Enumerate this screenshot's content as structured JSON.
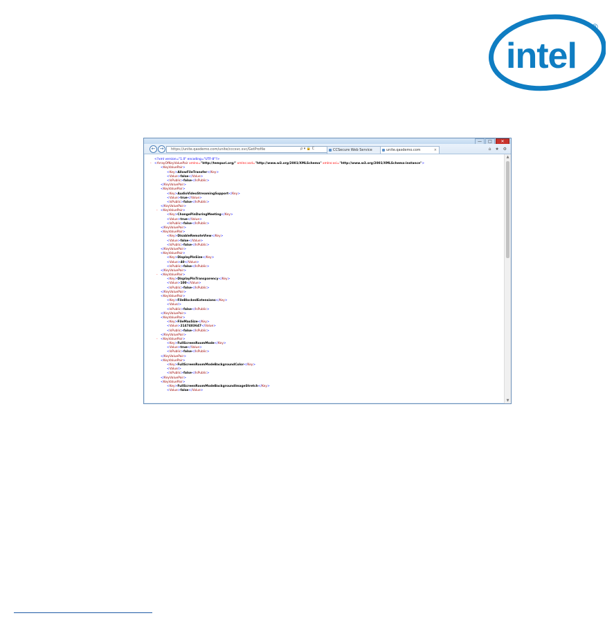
{
  "logo": {
    "text": "intel"
  },
  "browser": {
    "window_buttons": [
      "—",
      "□",
      "✕"
    ],
    "back_glyph": "←",
    "forward_glyph": "→",
    "address_url": "https://unite.qasdemo.com/unite/cccsvc.svc/GetProfile",
    "address_icons": "ρ ▾ 🔒 C",
    "tabs": [
      {
        "label": "CCSecure Web Service",
        "active": false
      },
      {
        "label": "unite.qasdemo.com",
        "active": true
      }
    ],
    "toolbar_icons": "⌂ ★ ⚙",
    "scroll_up": "▲",
    "scroll_down": "▼"
  },
  "xml": {
    "declaration": "<?xml version=\"1.0\" encoding=\"UTF-8\"?>",
    "root_open": "ArrayOfKeyValuePair",
    "root_attrs": [
      {
        "name": "xmlns",
        "value": "\"http://tempuri.org/\""
      },
      {
        "name": "xmlns:xsd",
        "value": "\"http://www.w3.org/2001/XMLSchema\""
      },
      {
        "name": "xmlns:xsi",
        "value": "\"http://www.w3.org/2001/XMLSchema-instance\""
      }
    ],
    "pairs": [
      {
        "minus": false,
        "key": "AllowFileTransfer",
        "value": "false",
        "isPublic": "false"
      },
      {
        "minus": false,
        "key": "AudioVideoStreamingSupport",
        "value": "true",
        "isPublic": "false"
      },
      {
        "minus": true,
        "key": "ChangePinDuringMeeting",
        "value": "true",
        "isPublic": "false"
      },
      {
        "minus": false,
        "key": "DisableRemoteView",
        "value": "false",
        "isPublic": "false"
      },
      {
        "minus": false,
        "key": "DisplayPinSize",
        "value": "40",
        "isPublic": "false"
      },
      {
        "minus": true,
        "key": "DisplayPinTransparency",
        "value": "100",
        "isPublic": "false"
      },
      {
        "minus": false,
        "key": "FileBlockedExtensions",
        "value": null,
        "isPublic": "false"
      },
      {
        "minus": false,
        "key": "FileMaxSize",
        "value": "2147483647",
        "isPublic": "false"
      },
      {
        "minus": true,
        "key": "FullScreenRoomMode",
        "value": "true",
        "isPublic": "false"
      },
      {
        "minus": false,
        "key": "FullScreenRoomModeBackgroundColor",
        "value": null,
        "isPublic": "false"
      },
      {
        "minus": false,
        "key": "FullScreenRoomModeBackgroundImageStretch",
        "value": "false",
        "isPublic": null
      }
    ]
  }
}
